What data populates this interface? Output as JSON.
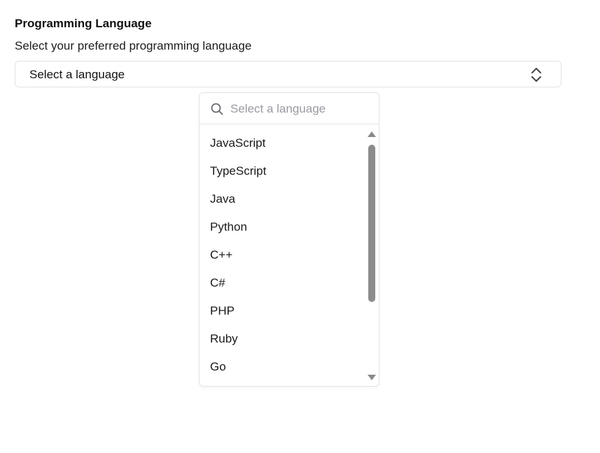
{
  "field": {
    "label": "Programming Language",
    "description": "Select your preferred programming language"
  },
  "select": {
    "value": "Select a language",
    "icon": "chevrons-up-down-icon"
  },
  "dropdown": {
    "search": {
      "placeholder": "Select a language",
      "value": "",
      "icon": "search-icon"
    },
    "options": [
      "JavaScript",
      "TypeScript",
      "Java",
      "Python",
      "C++",
      "C#",
      "PHP",
      "Ruby",
      "Go"
    ],
    "scroll_fraction": 0.0
  },
  "colors": {
    "border": "#e2e2e5",
    "text": "#111111",
    "placeholder": "#9a9aa2",
    "scroll_thumb": "#8c8c8c"
  }
}
